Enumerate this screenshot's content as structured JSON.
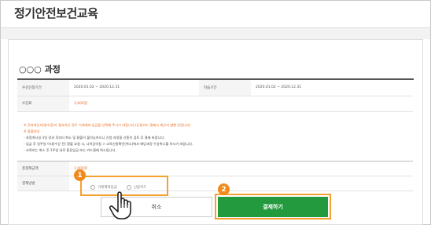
{
  "header": {
    "title": "정기안전보건교육"
  },
  "course": {
    "title": "○○○ 과정",
    "rows": [
      {
        "label": "수강신청기간",
        "value": "2020.01.02 ~ 2020.12.31",
        "label2": "학습기간",
        "value2": "2020.01.02 ~ 2020.12.31"
      },
      {
        "label": "수강료",
        "value": "1,000원"
      }
    ]
  },
  "notice": {
    "tax_note": "※ 전자계산서(영수증)가 필요하신 경우 거래계좌 입금을 선택해 주시기 바랍니다.(신용카드 결제시 계산서 발행 안됩니다)",
    "refund_head": "※ 환불안내",
    "lines": [
      "- 과정개시일 3일 경과 후부터 취소 및 환불이 불가능하오니 신청 과정을 신중히 검토 후 결제 바랍니다.",
      "- 입금 후 일주일 이내(수강 전) 환불 요청 시, 나의강의실 > 교육신청확인(취소)에서 해당과정 수강취소를 하시기 바랍니다.",
      "- 교육비는 취소 후 1주일 내로 통장입금 또는 카드결제 취소됩니다."
    ]
  },
  "payment": {
    "total_label": "총결제금액",
    "total_value": "1,000원",
    "method_label": "결제방법",
    "options": [
      "거래계좌입금",
      "신용카드"
    ]
  },
  "buttons": {
    "cancel": "취소",
    "pay": "결제하기"
  },
  "callouts": [
    "1",
    "2"
  ],
  "colors": {
    "accent": "#239a3d",
    "highlight": "#f5a030",
    "badge": "#f08a1c",
    "price": "#e86a1e"
  },
  "icons": [
    "hand-pointer-icon"
  ]
}
